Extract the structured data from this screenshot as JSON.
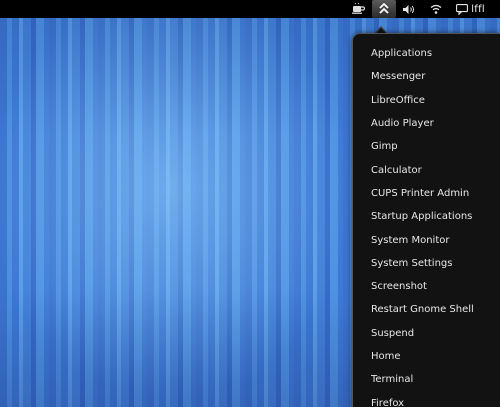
{
  "top_panel": {
    "icons": [
      "coffee-cup-icon",
      "user-menu-icon",
      "volume-icon",
      "network-wireless-icon",
      "chat-icon"
    ],
    "lffl_label": "lffl"
  },
  "menu": {
    "items": [
      {
        "label": "Applications"
      },
      {
        "label": "Messenger"
      },
      {
        "label": "LibreOffice"
      },
      {
        "label": "Audio Player"
      },
      {
        "label": "Gimp"
      },
      {
        "label": "Calculator"
      },
      {
        "label": "CUPS Printer Admin"
      },
      {
        "label": "Startup Applications"
      },
      {
        "label": "System Monitor"
      },
      {
        "label": "System Settings"
      },
      {
        "label": "Screenshot"
      },
      {
        "label": "Restart Gnome Shell"
      },
      {
        "label": "Suspend"
      },
      {
        "label": "Home"
      },
      {
        "label": "Terminal"
      },
      {
        "label": "Firefox"
      }
    ]
  },
  "colors": {
    "panel_bg": "#000000",
    "menu_bg": "#121212",
    "menu_text": "#e8e8e8",
    "wallpaper_accent": "#4f92e3"
  }
}
